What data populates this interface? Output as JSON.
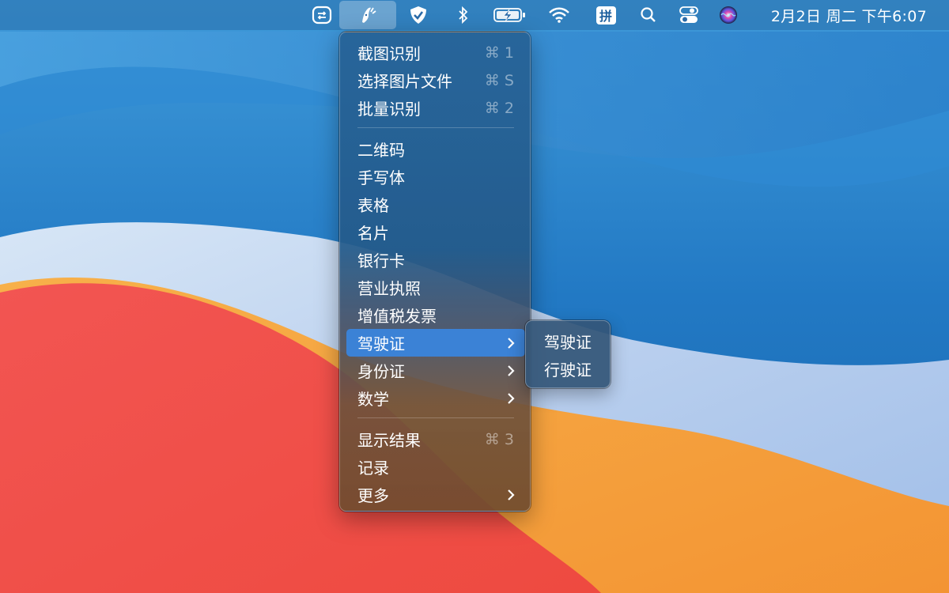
{
  "menubar": {
    "icons": [
      {
        "name": "app-switch-icon"
      },
      {
        "name": "ocr-app-icon"
      },
      {
        "name": "shield-check-icon"
      },
      {
        "name": "bluetooth-icon"
      },
      {
        "name": "battery-charging-icon"
      },
      {
        "name": "wifi-icon"
      },
      {
        "name": "input-method-icon"
      },
      {
        "name": "search-icon"
      },
      {
        "name": "control-center-icon"
      },
      {
        "name": "siri-icon"
      }
    ],
    "input_method_label": "拼",
    "clock": "2月2日 周二 下午6:07"
  },
  "menu": {
    "group1": [
      {
        "label": "截图识别",
        "shortcut": "⌘ 1"
      },
      {
        "label": "选择图片文件",
        "shortcut": "⌘ S"
      },
      {
        "label": "批量识别",
        "shortcut": "⌘ 2"
      }
    ],
    "group2": [
      {
        "label": "二维码"
      },
      {
        "label": "手写体"
      },
      {
        "label": "表格"
      },
      {
        "label": "名片"
      },
      {
        "label": "银行卡"
      },
      {
        "label": "营业执照"
      },
      {
        "label": "增值税发票"
      },
      {
        "label": "驾驶证",
        "has_submenu": true,
        "highlighted": true
      },
      {
        "label": "身份证",
        "has_submenu": true
      },
      {
        "label": "数学",
        "has_submenu": true
      }
    ],
    "group3": [
      {
        "label": "显示结果",
        "shortcut": "⌘ 3"
      },
      {
        "label": "记录"
      },
      {
        "label": "更多",
        "has_submenu": true
      }
    ]
  },
  "submenu": {
    "items": [
      {
        "label": "驾驶证"
      },
      {
        "label": "行驶证"
      }
    ]
  },
  "colors": {
    "highlight": "#3b82d6",
    "wallpaper_blue": "#1d6fb8",
    "wallpaper_red": "#f04e48",
    "wallpaper_orange": "#f5a23a"
  }
}
